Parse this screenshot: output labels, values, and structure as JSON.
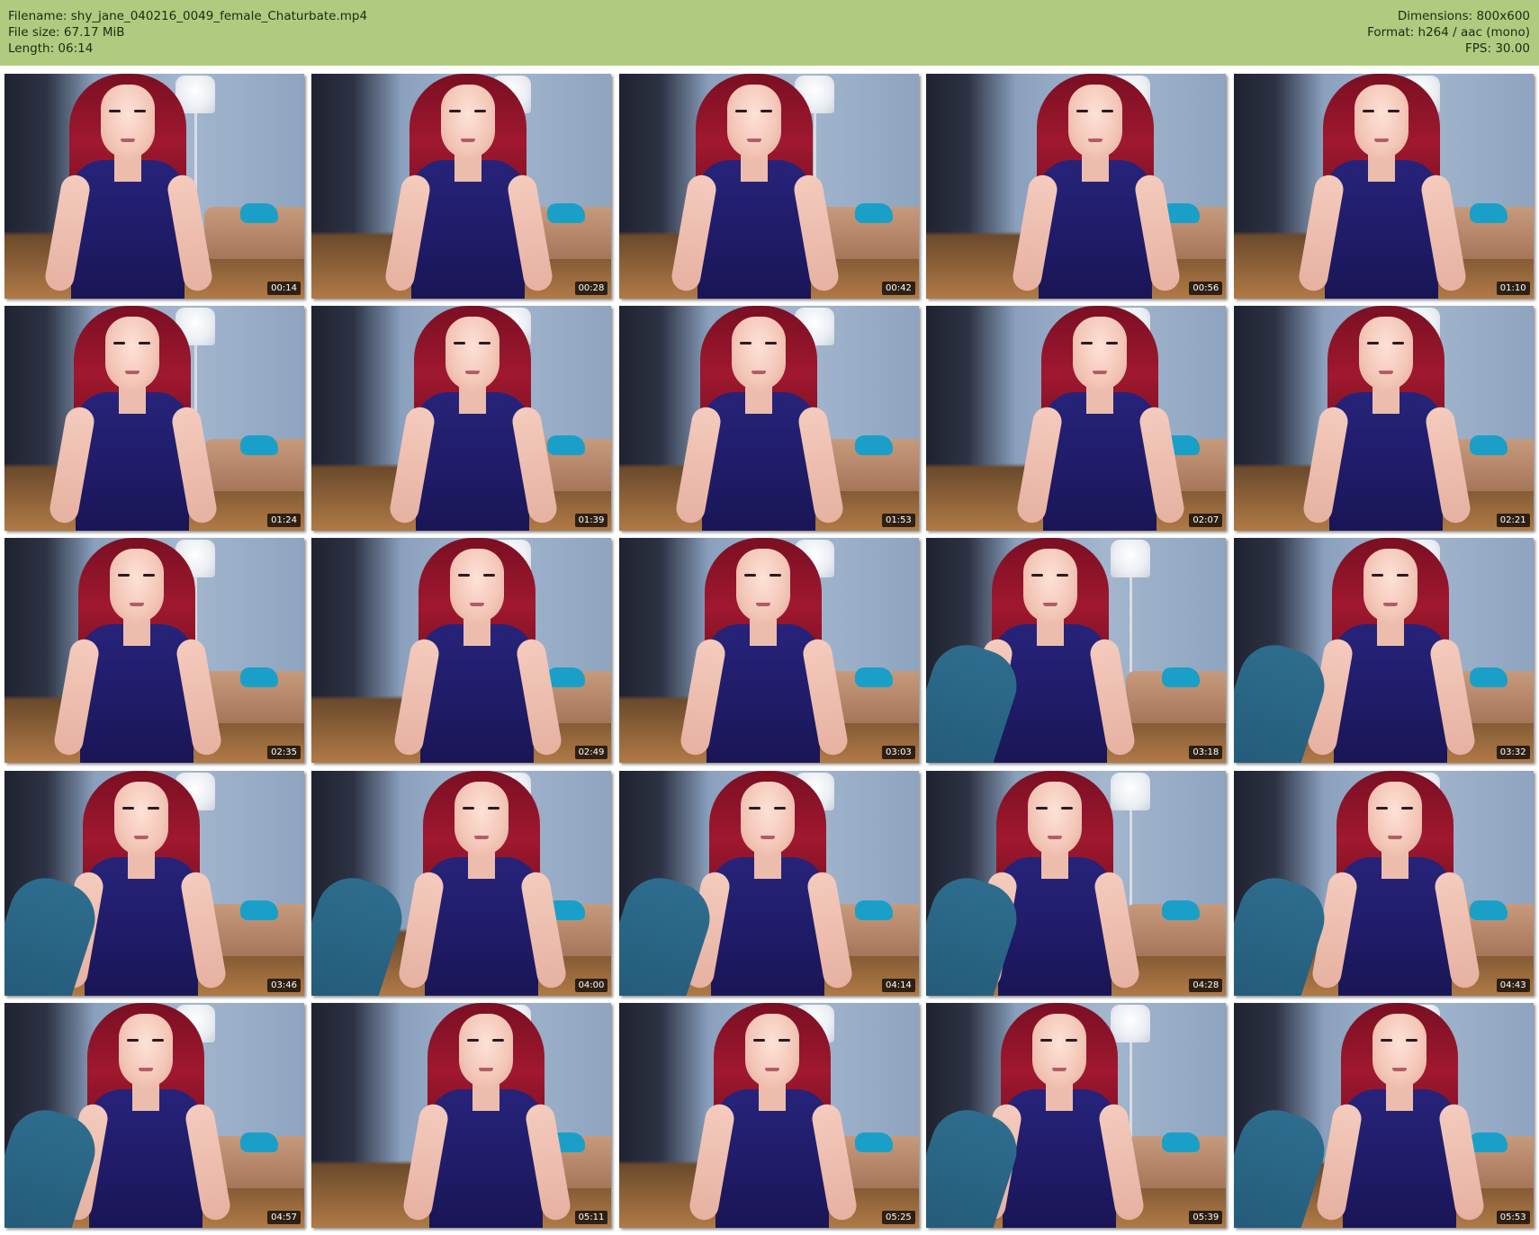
{
  "header": {
    "filename_label": "Filename:",
    "filename_value": "shy_jane_040216_0049_female_Chaturbate.mp4",
    "filesize_label": "File size:",
    "filesize_value": "67.17 MiB",
    "length_label": "Length:",
    "length_value": "06:14",
    "dimensions_label": "Dimensions:",
    "dimensions_value": "800x600",
    "format_label": "Format:",
    "format_value": "h264 / aac (mono)",
    "fps_label": "FPS:",
    "fps_value": "30.00"
  },
  "colors": {
    "header_bg": "#b0cb7f",
    "page_bg": "#ffffff"
  },
  "thumbnails": [
    {
      "time": "00:14",
      "leg": false
    },
    {
      "time": "00:28",
      "leg": false
    },
    {
      "time": "00:42",
      "leg": false
    },
    {
      "time": "00:56",
      "leg": false
    },
    {
      "time": "01:10",
      "leg": false
    },
    {
      "time": "01:24",
      "leg": false
    },
    {
      "time": "01:39",
      "leg": false
    },
    {
      "time": "01:53",
      "leg": false
    },
    {
      "time": "02:07",
      "leg": false
    },
    {
      "time": "02:21",
      "leg": false
    },
    {
      "time": "02:35",
      "leg": false
    },
    {
      "time": "02:49",
      "leg": false
    },
    {
      "time": "03:03",
      "leg": false
    },
    {
      "time": "03:18",
      "leg": true
    },
    {
      "time": "03:32",
      "leg": true
    },
    {
      "time": "03:46",
      "leg": true
    },
    {
      "time": "04:00",
      "leg": true
    },
    {
      "time": "04:14",
      "leg": true
    },
    {
      "time": "04:28",
      "leg": true
    },
    {
      "time": "04:43",
      "leg": true
    },
    {
      "time": "04:57",
      "leg": true
    },
    {
      "time": "05:11",
      "leg": false
    },
    {
      "time": "05:25",
      "leg": false
    },
    {
      "time": "05:39",
      "leg": true
    },
    {
      "time": "05:53",
      "leg": true
    }
  ]
}
